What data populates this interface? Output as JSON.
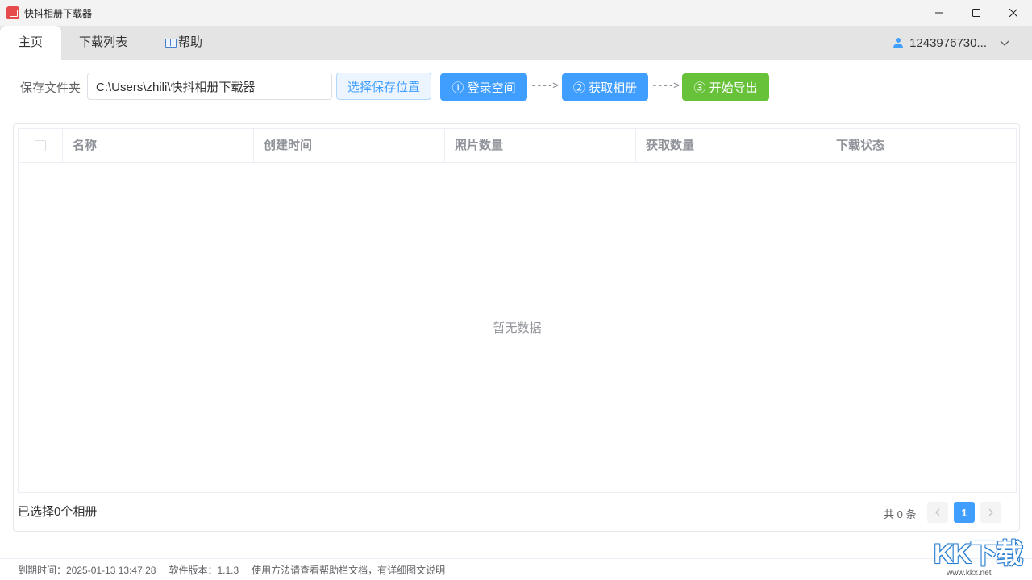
{
  "window": {
    "title": "快抖相册下载器",
    "controls": {
      "minimize": "minimize-icon",
      "maximize": "maximize-icon",
      "close": "close-icon"
    }
  },
  "tabs": [
    {
      "label": "主页",
      "active": true
    },
    {
      "label": "下载列表",
      "active": false
    },
    {
      "label": "帮助",
      "active": false,
      "icon": "book-icon"
    }
  ],
  "user": {
    "account": "1243976730...",
    "icon": "user-icon"
  },
  "toolbar": {
    "save_label": "保存文件夹",
    "save_path": "C:\\Users\\zhili\\快抖相册下载器",
    "choose_button": "选择保存位置",
    "step1": "① 登录空间",
    "step2": "② 获取相册",
    "step3": "③ 开始导出",
    "arrow": "---->"
  },
  "table": {
    "columns": [
      "名称",
      "创建时间",
      "照片数量",
      "获取数量",
      "下载状态"
    ],
    "rows": [],
    "empty_text": "暂无数据"
  },
  "footer": {
    "selected": "已选择0个相册",
    "total": "共 0 条",
    "current_page": "1"
  },
  "statusbar": {
    "expire": "到期时间：2025-01-13 13:47:28",
    "version": "软件版本：1.1.3",
    "help": "使用方法请查看帮助栏文档，有详细图文说明"
  },
  "watermark": {
    "text": "KK下载",
    "url": "www.kkx.net"
  },
  "colors": {
    "primary": "#409eff",
    "success": "#67c23a",
    "app_icon": "#e64a4a"
  }
}
